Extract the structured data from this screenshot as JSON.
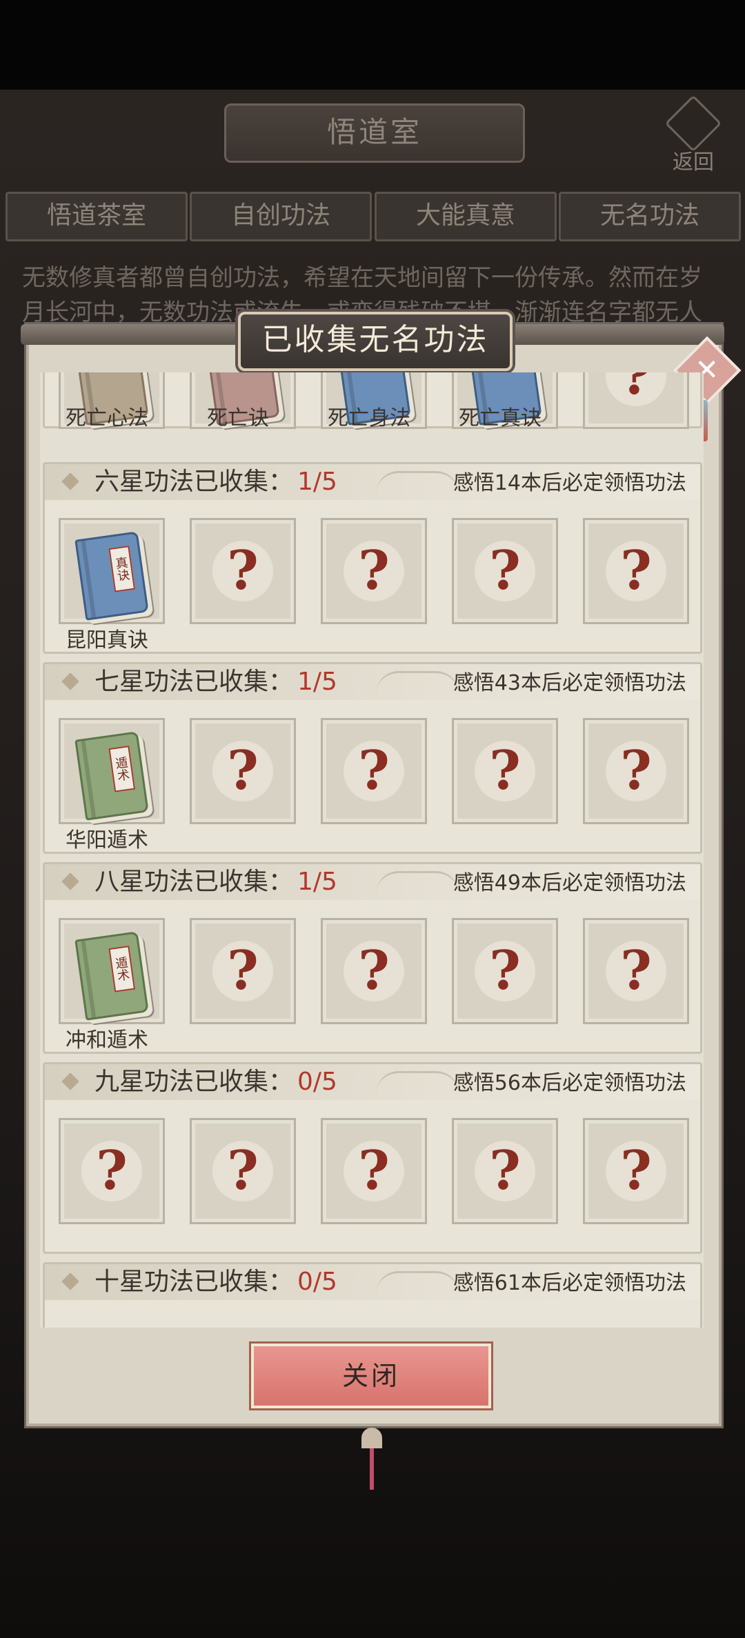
{
  "background": {
    "title": "悟道室",
    "back_label": "返回",
    "tabs": [
      "悟道茶室",
      "自创功法",
      "大能真意",
      "无名功法"
    ],
    "description_line1": "无数修真者都曾自创功法，希望在天地间留下一份传承。然而在岁",
    "description_line2": "月长河中，无数功法或流失，或变得残破不堪，渐渐连名字都无人"
  },
  "dialog": {
    "title": "已收集无名功法",
    "close_icon": "✕",
    "close_button": "关闭",
    "top_row_labels": [
      "死亡心法",
      "死亡诀",
      "死亡身法",
      "死亡真诀"
    ],
    "groups": [
      {
        "title": "六星功法已收集：",
        "count": "1/5",
        "hint": "感悟14本后必定领悟功法",
        "slots": [
          {
            "type": "book",
            "color": "blue",
            "tag": "真诀",
            "label": "昆阳真诀"
          },
          {
            "type": "unknown"
          },
          {
            "type": "unknown"
          },
          {
            "type": "unknown"
          },
          {
            "type": "unknown"
          }
        ]
      },
      {
        "title": "七星功法已收集：",
        "count": "1/5",
        "hint": "感悟43本后必定领悟功法",
        "slots": [
          {
            "type": "book",
            "color": "green",
            "tag": "遁术",
            "label": "华阳遁术"
          },
          {
            "type": "unknown"
          },
          {
            "type": "unknown"
          },
          {
            "type": "unknown"
          },
          {
            "type": "unknown"
          }
        ]
      },
      {
        "title": "八星功法已收集：",
        "count": "1/5",
        "hint": "感悟49本后必定领悟功法",
        "slots": [
          {
            "type": "book",
            "color": "green",
            "tag": "遁术",
            "label": "冲和遁术"
          },
          {
            "type": "unknown"
          },
          {
            "type": "unknown"
          },
          {
            "type": "unknown"
          },
          {
            "type": "unknown"
          }
        ]
      },
      {
        "title": "九星功法已收集：",
        "count": "0/5",
        "hint": "感悟56本后必定领悟功法",
        "slots": [
          {
            "type": "unknown"
          },
          {
            "type": "unknown"
          },
          {
            "type": "unknown"
          },
          {
            "type": "unknown"
          },
          {
            "type": "unknown"
          }
        ]
      },
      {
        "title": "十星功法已收集：",
        "count": "0/5",
        "hint": "感悟61本后必定领悟功法",
        "slots": []
      }
    ],
    "question_mark": "?"
  }
}
